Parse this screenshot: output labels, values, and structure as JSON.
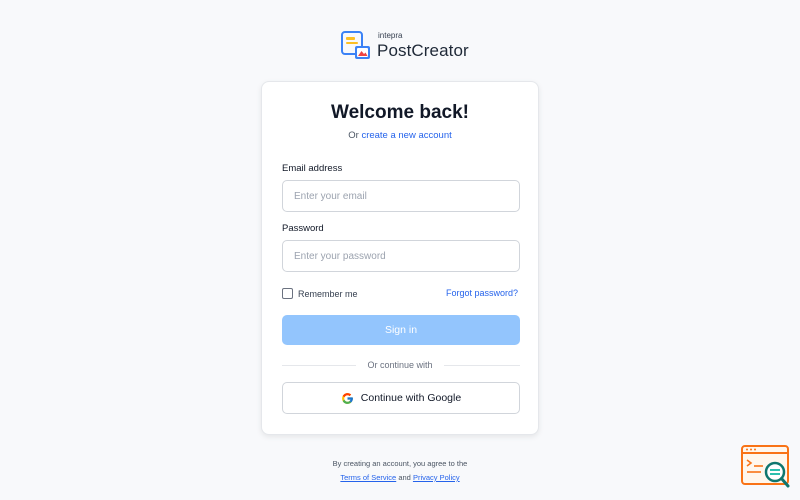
{
  "brand": {
    "small_name": "intepra",
    "app_name": "PostCreator",
    "logo_icon": "postcreator-logo-icon"
  },
  "login": {
    "title": "Welcome back!",
    "subtitle_prefix": "Or",
    "create_account_link": "create a new account",
    "email_label": "Email address",
    "email_placeholder": "Enter your email",
    "email_value": "",
    "password_label": "Password",
    "password_placeholder": "Enter your password",
    "password_value": "",
    "remember_label": "Remember me",
    "remember_checked": false,
    "forgot_link": "Forgot password?",
    "signin_label": "Sign in",
    "divider_text": "Or continue with",
    "google_label": "Continue with Google",
    "google_icon": "google-icon"
  },
  "footer": {
    "line1": "By creating an account, you agree to the",
    "terms_link": "Terms of Service",
    "and_text": "and",
    "privacy_link": "Privacy Policy"
  },
  "colors": {
    "background": "#f8f9fb",
    "accent": "#2563eb",
    "signin_button": "#93c5fd",
    "logo_blue": "#3b82f6",
    "logo_yellow": "#fbbf24",
    "logo_red": "#ef4444",
    "corner_orange": "#f97316",
    "corner_teal": "#14b8a6"
  },
  "corner_widget": {
    "icon": "search-feedback-icon"
  }
}
